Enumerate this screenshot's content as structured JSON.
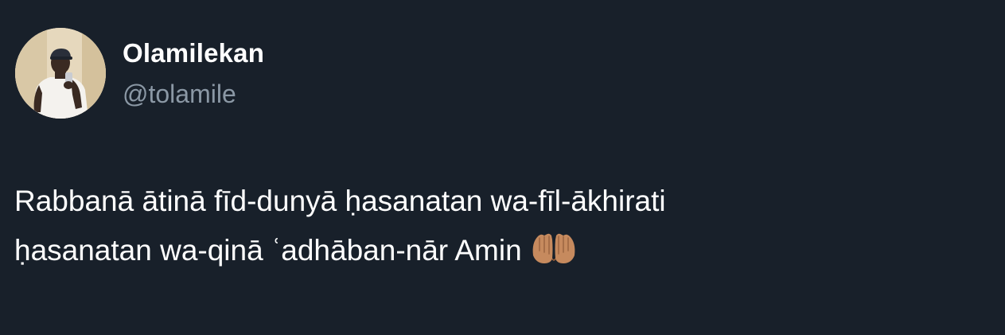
{
  "author": {
    "display_name": "Olamilekan",
    "handle": "@tolamile",
    "avatar_icon": "profile-photo"
  },
  "tweet": {
    "line1": "Rabbanā ātinā fīd-dunyā ḥasanatan wa-fīl-ākhirati",
    "line2": "ḥasanatan wa-qinā ʿadhāban-nār Amin",
    "emoji": "🤲🏽",
    "emoji_icon": "palms-up-together-icon"
  },
  "colors": {
    "background": "#18202a",
    "name": "#ffffff",
    "handle": "#8b98a5",
    "text": "#ffffff"
  }
}
